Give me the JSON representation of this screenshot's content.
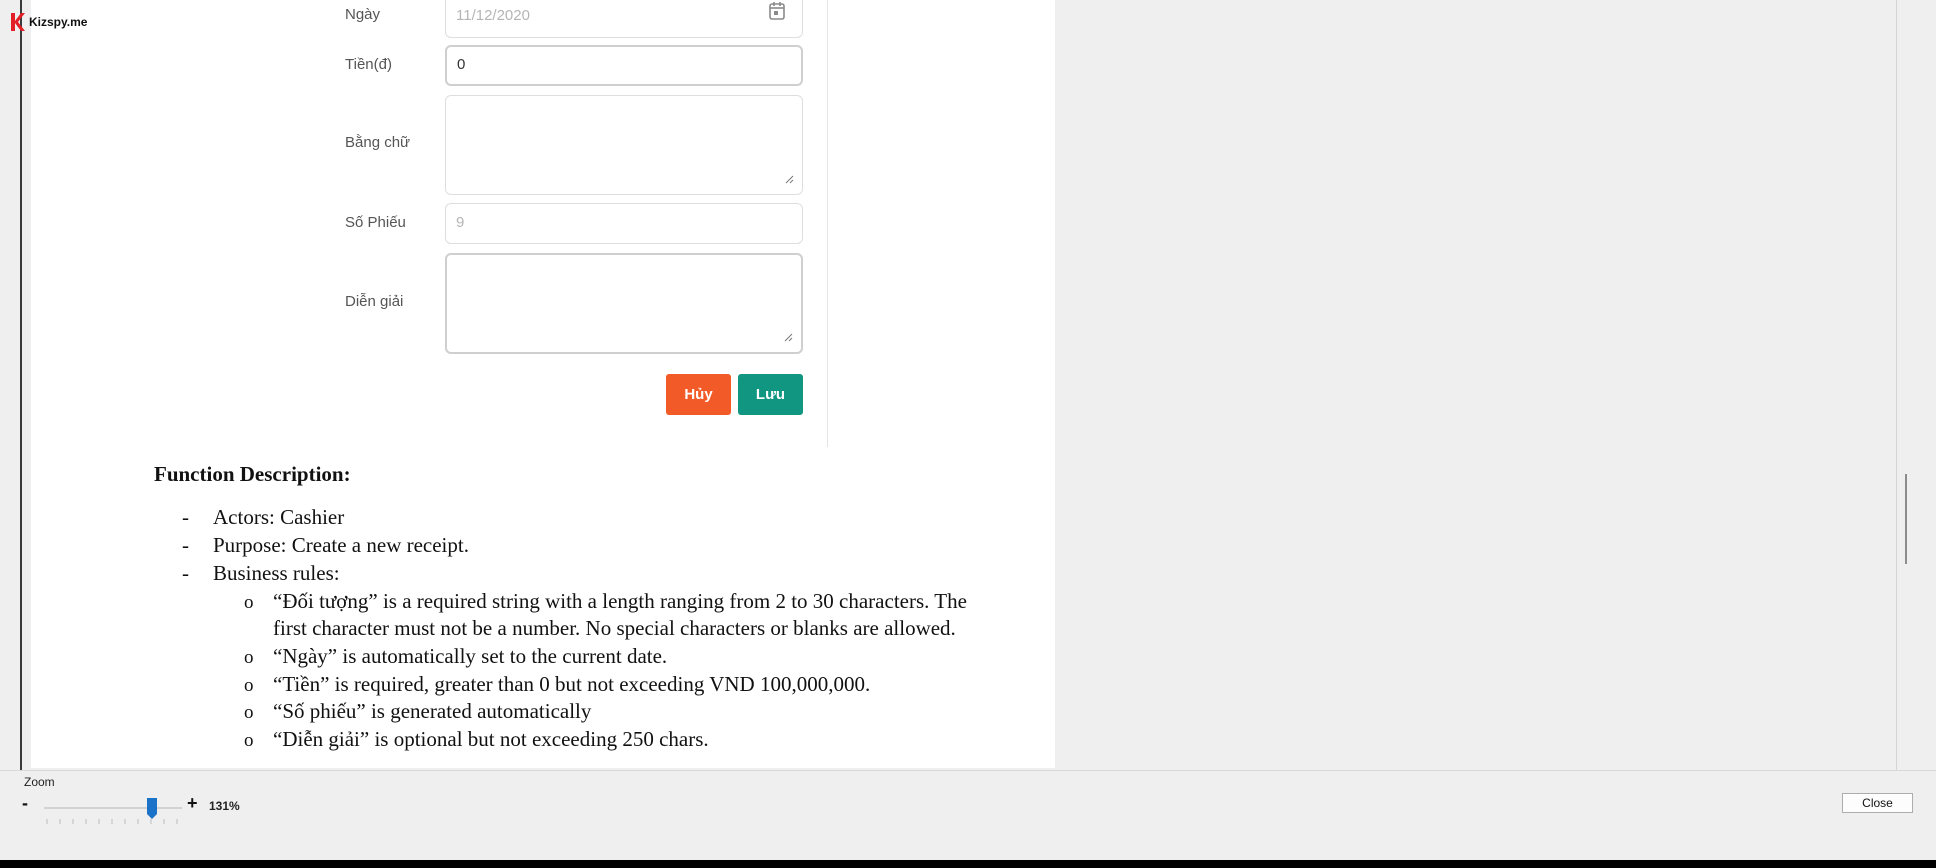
{
  "brand": {
    "name": "Kizspy.me",
    "accent": "#e21e26"
  },
  "form": {
    "fields": [
      {
        "label": "Ngày",
        "value": "11/12/2020",
        "icon": "calendar-icon"
      },
      {
        "label": "Tiền(đ)",
        "value": "0"
      },
      {
        "label": "Bằng chữ",
        "value": ""
      },
      {
        "label": "Số Phiếu",
        "value": "9"
      },
      {
        "label": "Diễn giải",
        "value": ""
      }
    ],
    "cancel_label": "Hủy",
    "save_label": "Lưu",
    "colors": {
      "cancel": "#f25a27",
      "save": "#119682"
    }
  },
  "doc": {
    "heading": "Function Description:",
    "dash": "-",
    "bullet": "o",
    "items": [
      "Actors: Cashier",
      "Purpose: Create a new receipt.",
      "Business rules:"
    ],
    "rules": [
      "“Đối tượng” is a required string with a length ranging from 2 to 30 characters. The",
      "first character must not be a number. No special characters or blanks are allowed.",
      "“Ngày” is automatically set to the current date.",
      " “Tiền” is required, greater than 0 but not exceeding VND 100,000,000.",
      "“Số phiếu” is generated automatically",
      "“Diễn giải” is optional but not exceeding 250 chars."
    ]
  },
  "zoom": {
    "label": "Zoom",
    "minus": "-",
    "plus": "+",
    "value_text": "131%",
    "level": 0.78
  },
  "close_label": "Close"
}
